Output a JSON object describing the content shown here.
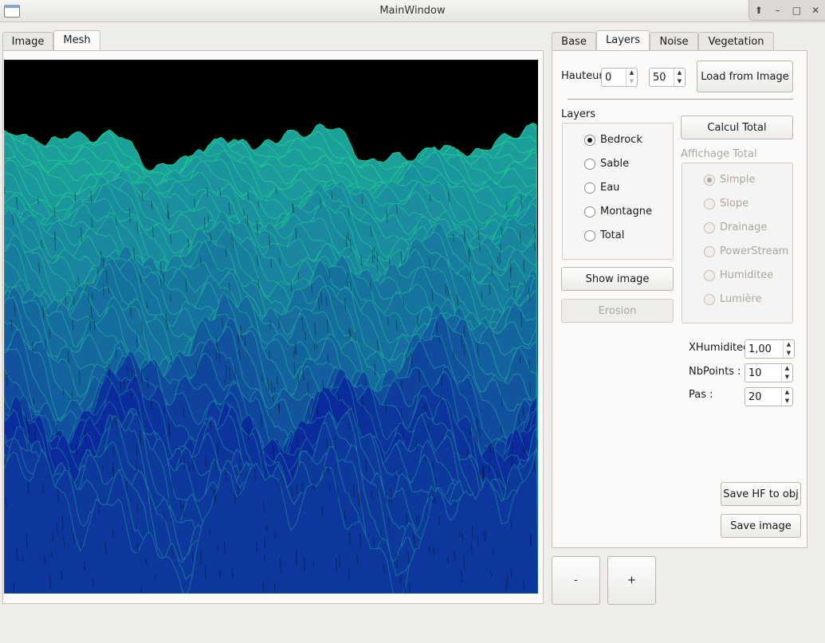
{
  "window": {
    "title": "MainWindow"
  },
  "left_tabs": [
    {
      "label": "Image"
    },
    {
      "label": "Mesh"
    }
  ],
  "right_tabs": [
    {
      "label": "Base"
    },
    {
      "label": "Layers"
    },
    {
      "label": "Noise"
    },
    {
      "label": "Vegetation"
    }
  ],
  "active_left_tab": "Mesh",
  "active_right_tab": "Layers",
  "hauteur": {
    "label": "Hauteur",
    "min_value": "0",
    "max_value": "50"
  },
  "load_from_image_label": "Load from Image",
  "layers": {
    "title": "Layers",
    "options": [
      {
        "label": "Bedrock",
        "checked": true
      },
      {
        "label": "Sable",
        "checked": false
      },
      {
        "label": "Eau",
        "checked": false
      },
      {
        "label": "Montagne",
        "checked": false
      },
      {
        "label": "Total",
        "checked": false
      }
    ]
  },
  "calcul_total_label": "Calcul Total",
  "affichage_total": {
    "title": "Affichage Total",
    "options": [
      {
        "label": "Simple",
        "checked": true
      },
      {
        "label": "Slope",
        "checked": false
      },
      {
        "label": "Drainage",
        "checked": false
      },
      {
        "label": "PowerStream",
        "checked": false
      },
      {
        "label": "Humiditee",
        "checked": false
      },
      {
        "label": "Lumière",
        "checked": false
      }
    ]
  },
  "show_image_label": "Show image",
  "erosion_label": "Erosion",
  "params": {
    "xhumiditee": {
      "label": "XHumiditee",
      "value": "1,00"
    },
    "nbpoints": {
      "label": "NbPoints :",
      "value": "10"
    },
    "pas": {
      "label": "Pas :",
      "value": "20"
    }
  },
  "save_hf_label": "Save HF to obj",
  "save_image_label": "Save image",
  "zoom_out_label": "-",
  "zoom_in_label": "+",
  "colors": {
    "terrain_high": "#1fdc8a",
    "terrain_mid": "#1b8f9f",
    "terrain_low": "#0b2a9c",
    "background": "#000000"
  }
}
